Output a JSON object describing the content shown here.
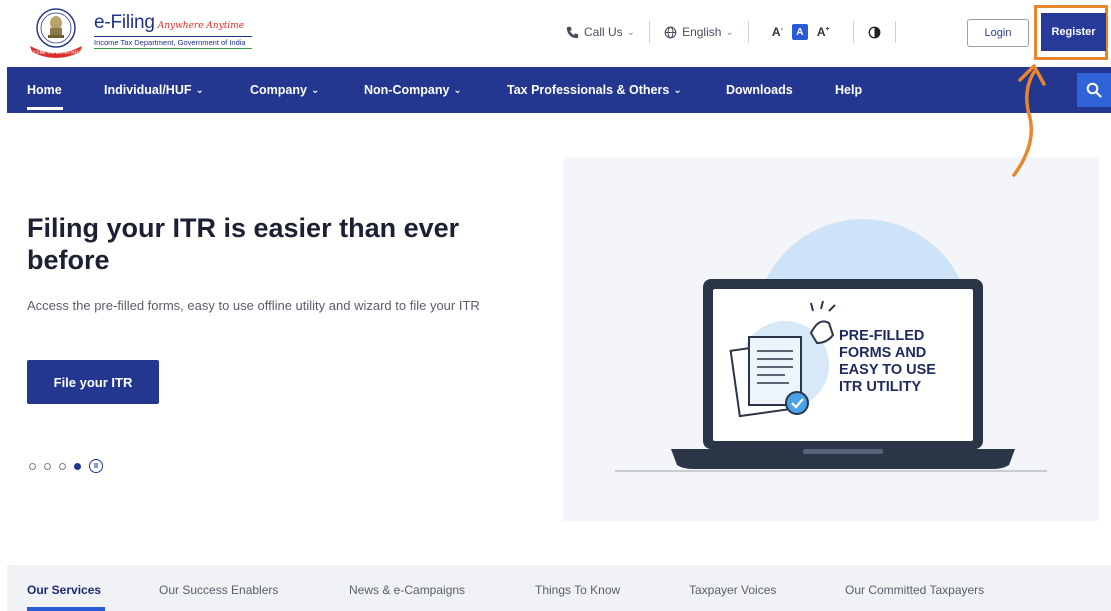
{
  "header": {
    "logo": {
      "name": "e-Filing",
      "tagline": "Anywhere Anytime",
      "subtitle": "Income Tax Department, Government of India"
    },
    "utility": {
      "call_us": "Call Us",
      "language": "English",
      "font_decrease": "A",
      "font_default": "A",
      "font_increase": "A",
      "contrast_icon": "contrast-icon"
    },
    "login_label": "Login",
    "register_label": "Register",
    "highlight_color": "#e8862e"
  },
  "nav": {
    "items": [
      {
        "label": "Home",
        "active": true
      },
      {
        "label": "Individual/HUF",
        "dropdown": true
      },
      {
        "label": "Company",
        "dropdown": true
      },
      {
        "label": "Non-Company",
        "dropdown": true
      },
      {
        "label": "Tax Professionals & Others",
        "dropdown": true
      },
      {
        "label": "Downloads"
      },
      {
        "label": "Help"
      }
    ],
    "search_icon": "search-icon",
    "color": "#233690"
  },
  "hero": {
    "title": "Filing your ITR is easier than ever before",
    "description": "Access the pre-filled forms, easy to use offline utility and wizard to file your ITR",
    "cta_label": "File your ITR",
    "illustration_text": [
      "PRE-FILLED",
      "FORMS AND",
      "EASY TO USE",
      "ITR UTILITY"
    ],
    "carousel_active_slide": 4,
    "carousel_slide_count": 4,
    "pause_icon": "pause-icon"
  },
  "tabs": [
    {
      "label": "Our Services",
      "active": true
    },
    {
      "label": "Our Success Enablers"
    },
    {
      "label": "News & e-Campaigns"
    },
    {
      "label": "Things To Know"
    },
    {
      "label": "Taxpayer Voices"
    },
    {
      "label": "Our Committed Taxpayers"
    }
  ]
}
